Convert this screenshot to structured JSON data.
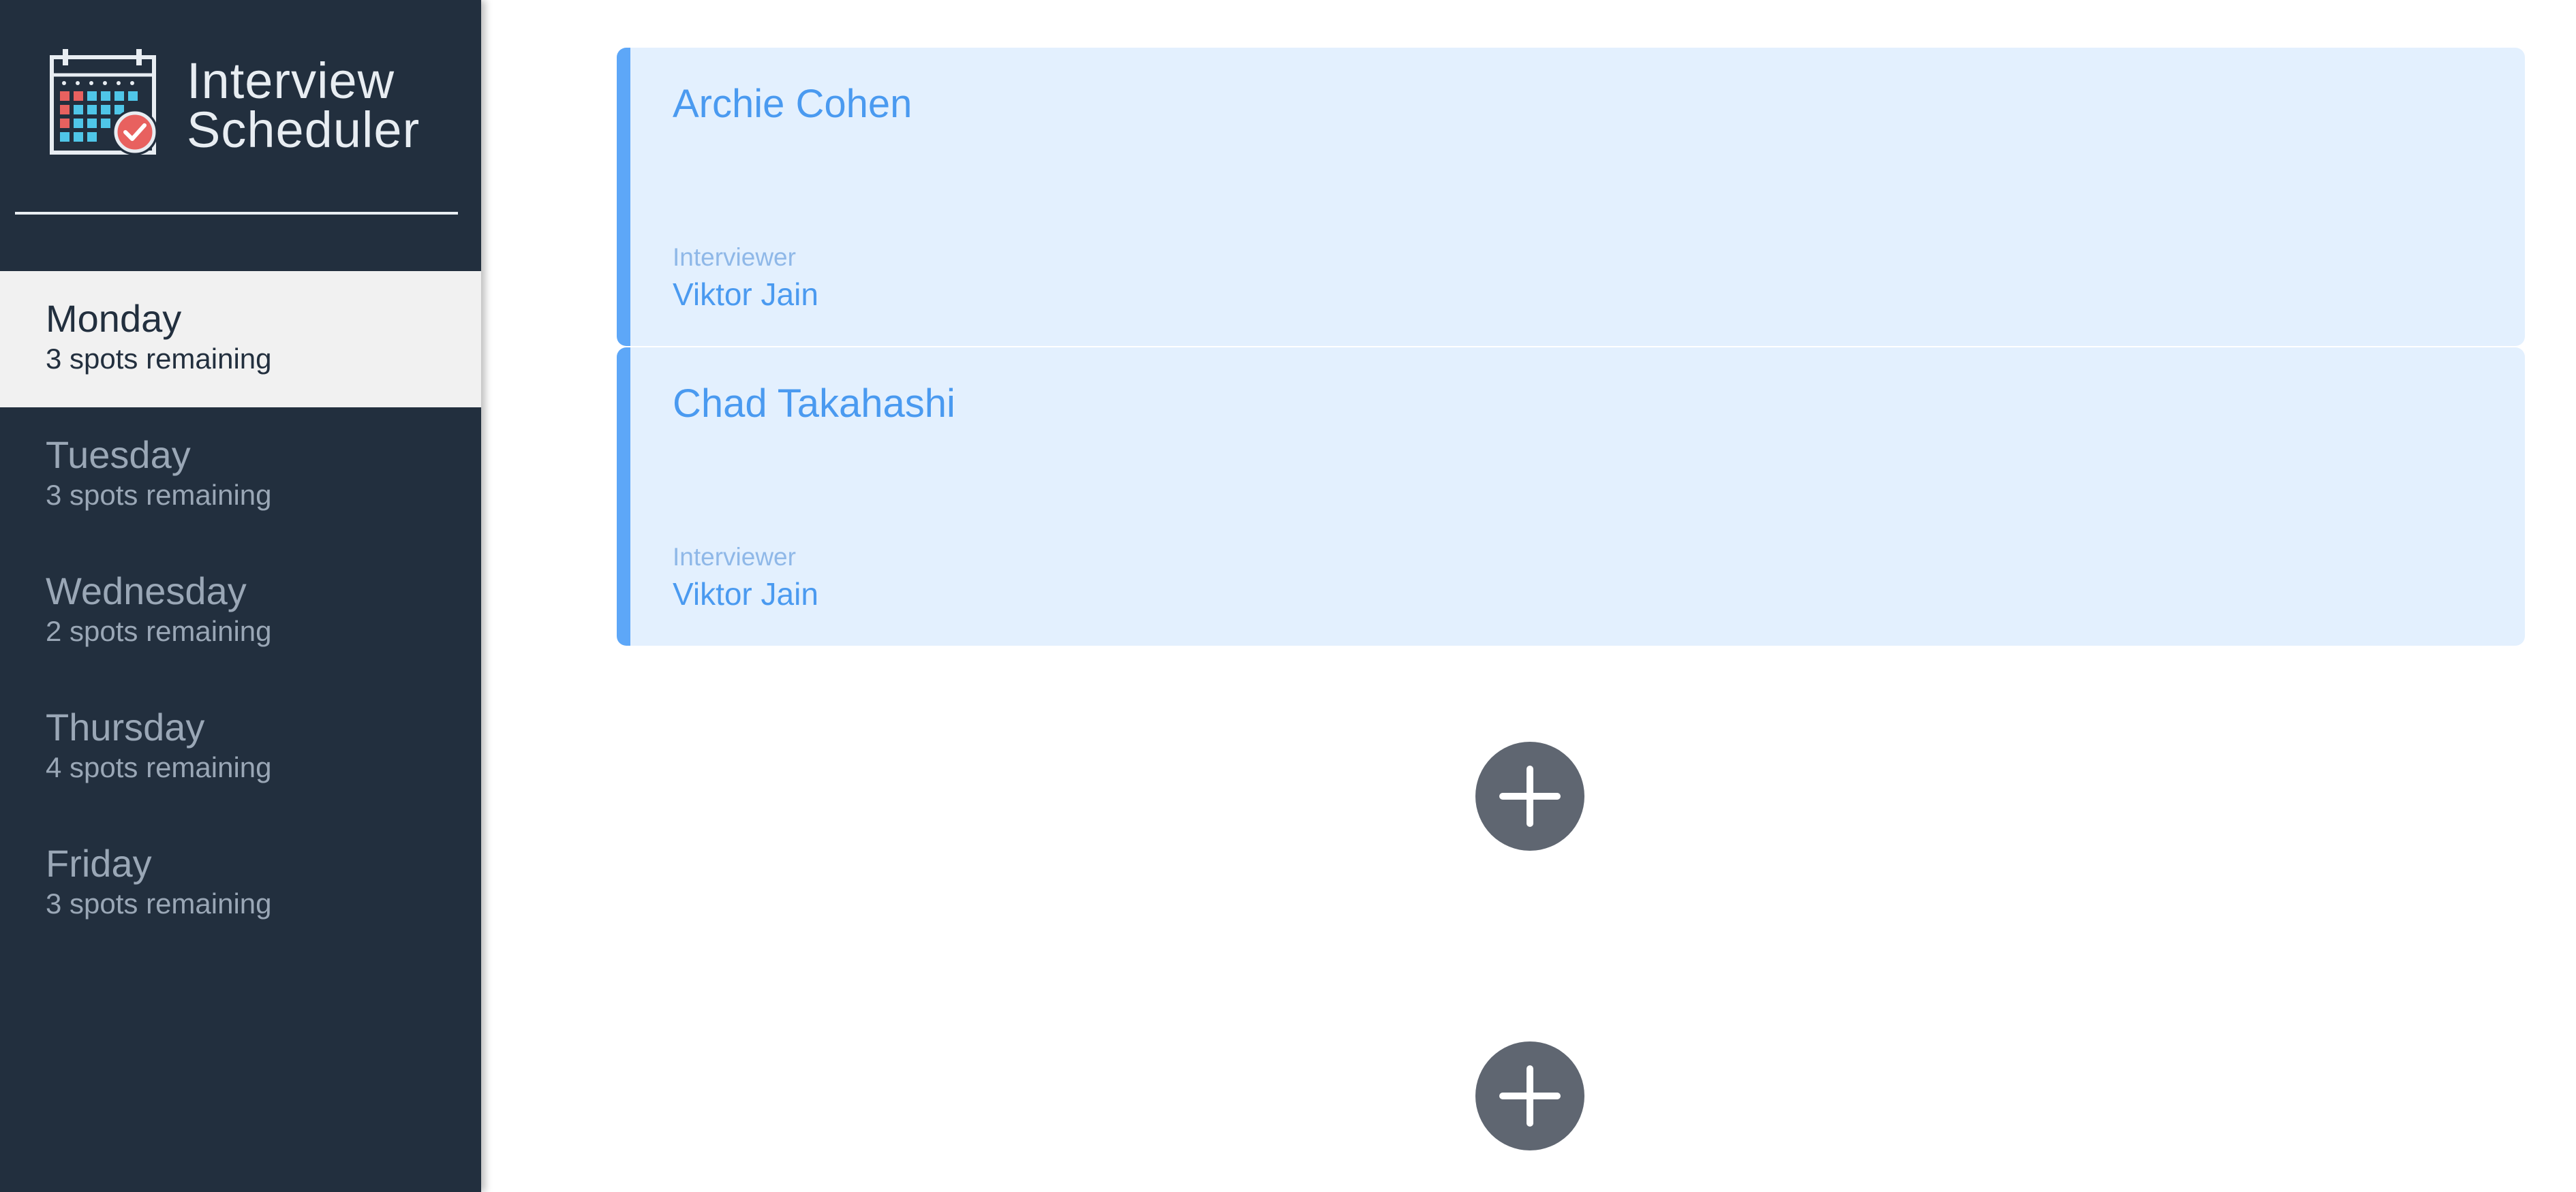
{
  "app": {
    "title_line1": "Interview",
    "title_line2": "Scheduler"
  },
  "sidebar": {
    "days": [
      {
        "name": "Monday",
        "spots": "3 spots remaining",
        "selected": true
      },
      {
        "name": "Tuesday",
        "spots": "3 spots remaining",
        "selected": false
      },
      {
        "name": "Wednesday",
        "spots": "2 spots remaining",
        "selected": false
      },
      {
        "name": "Thursday",
        "spots": "4 spots remaining",
        "selected": false
      },
      {
        "name": "Friday",
        "spots": "3 spots remaining",
        "selected": false
      }
    ]
  },
  "appointments": [
    {
      "student": "Archie Cohen",
      "interviewer_label": "Interviewer",
      "interviewer": "Viktor Jain"
    },
    {
      "student": "Chad Takahashi",
      "interviewer_label": "Interviewer",
      "interviewer": "Viktor Jain"
    }
  ],
  "empty_slots": [
    {
      "icon": "plus-icon"
    },
    {
      "icon": "plus-icon"
    }
  ],
  "colors": {
    "sidebar_bg": "#222f3e",
    "selected_day_bg": "#f1f1f1",
    "appointment_bg": "#e3f0fe",
    "appointment_accent": "#5da7f8",
    "appointment_text": "#4a9af0",
    "add_button_bg": "#5f6671"
  }
}
